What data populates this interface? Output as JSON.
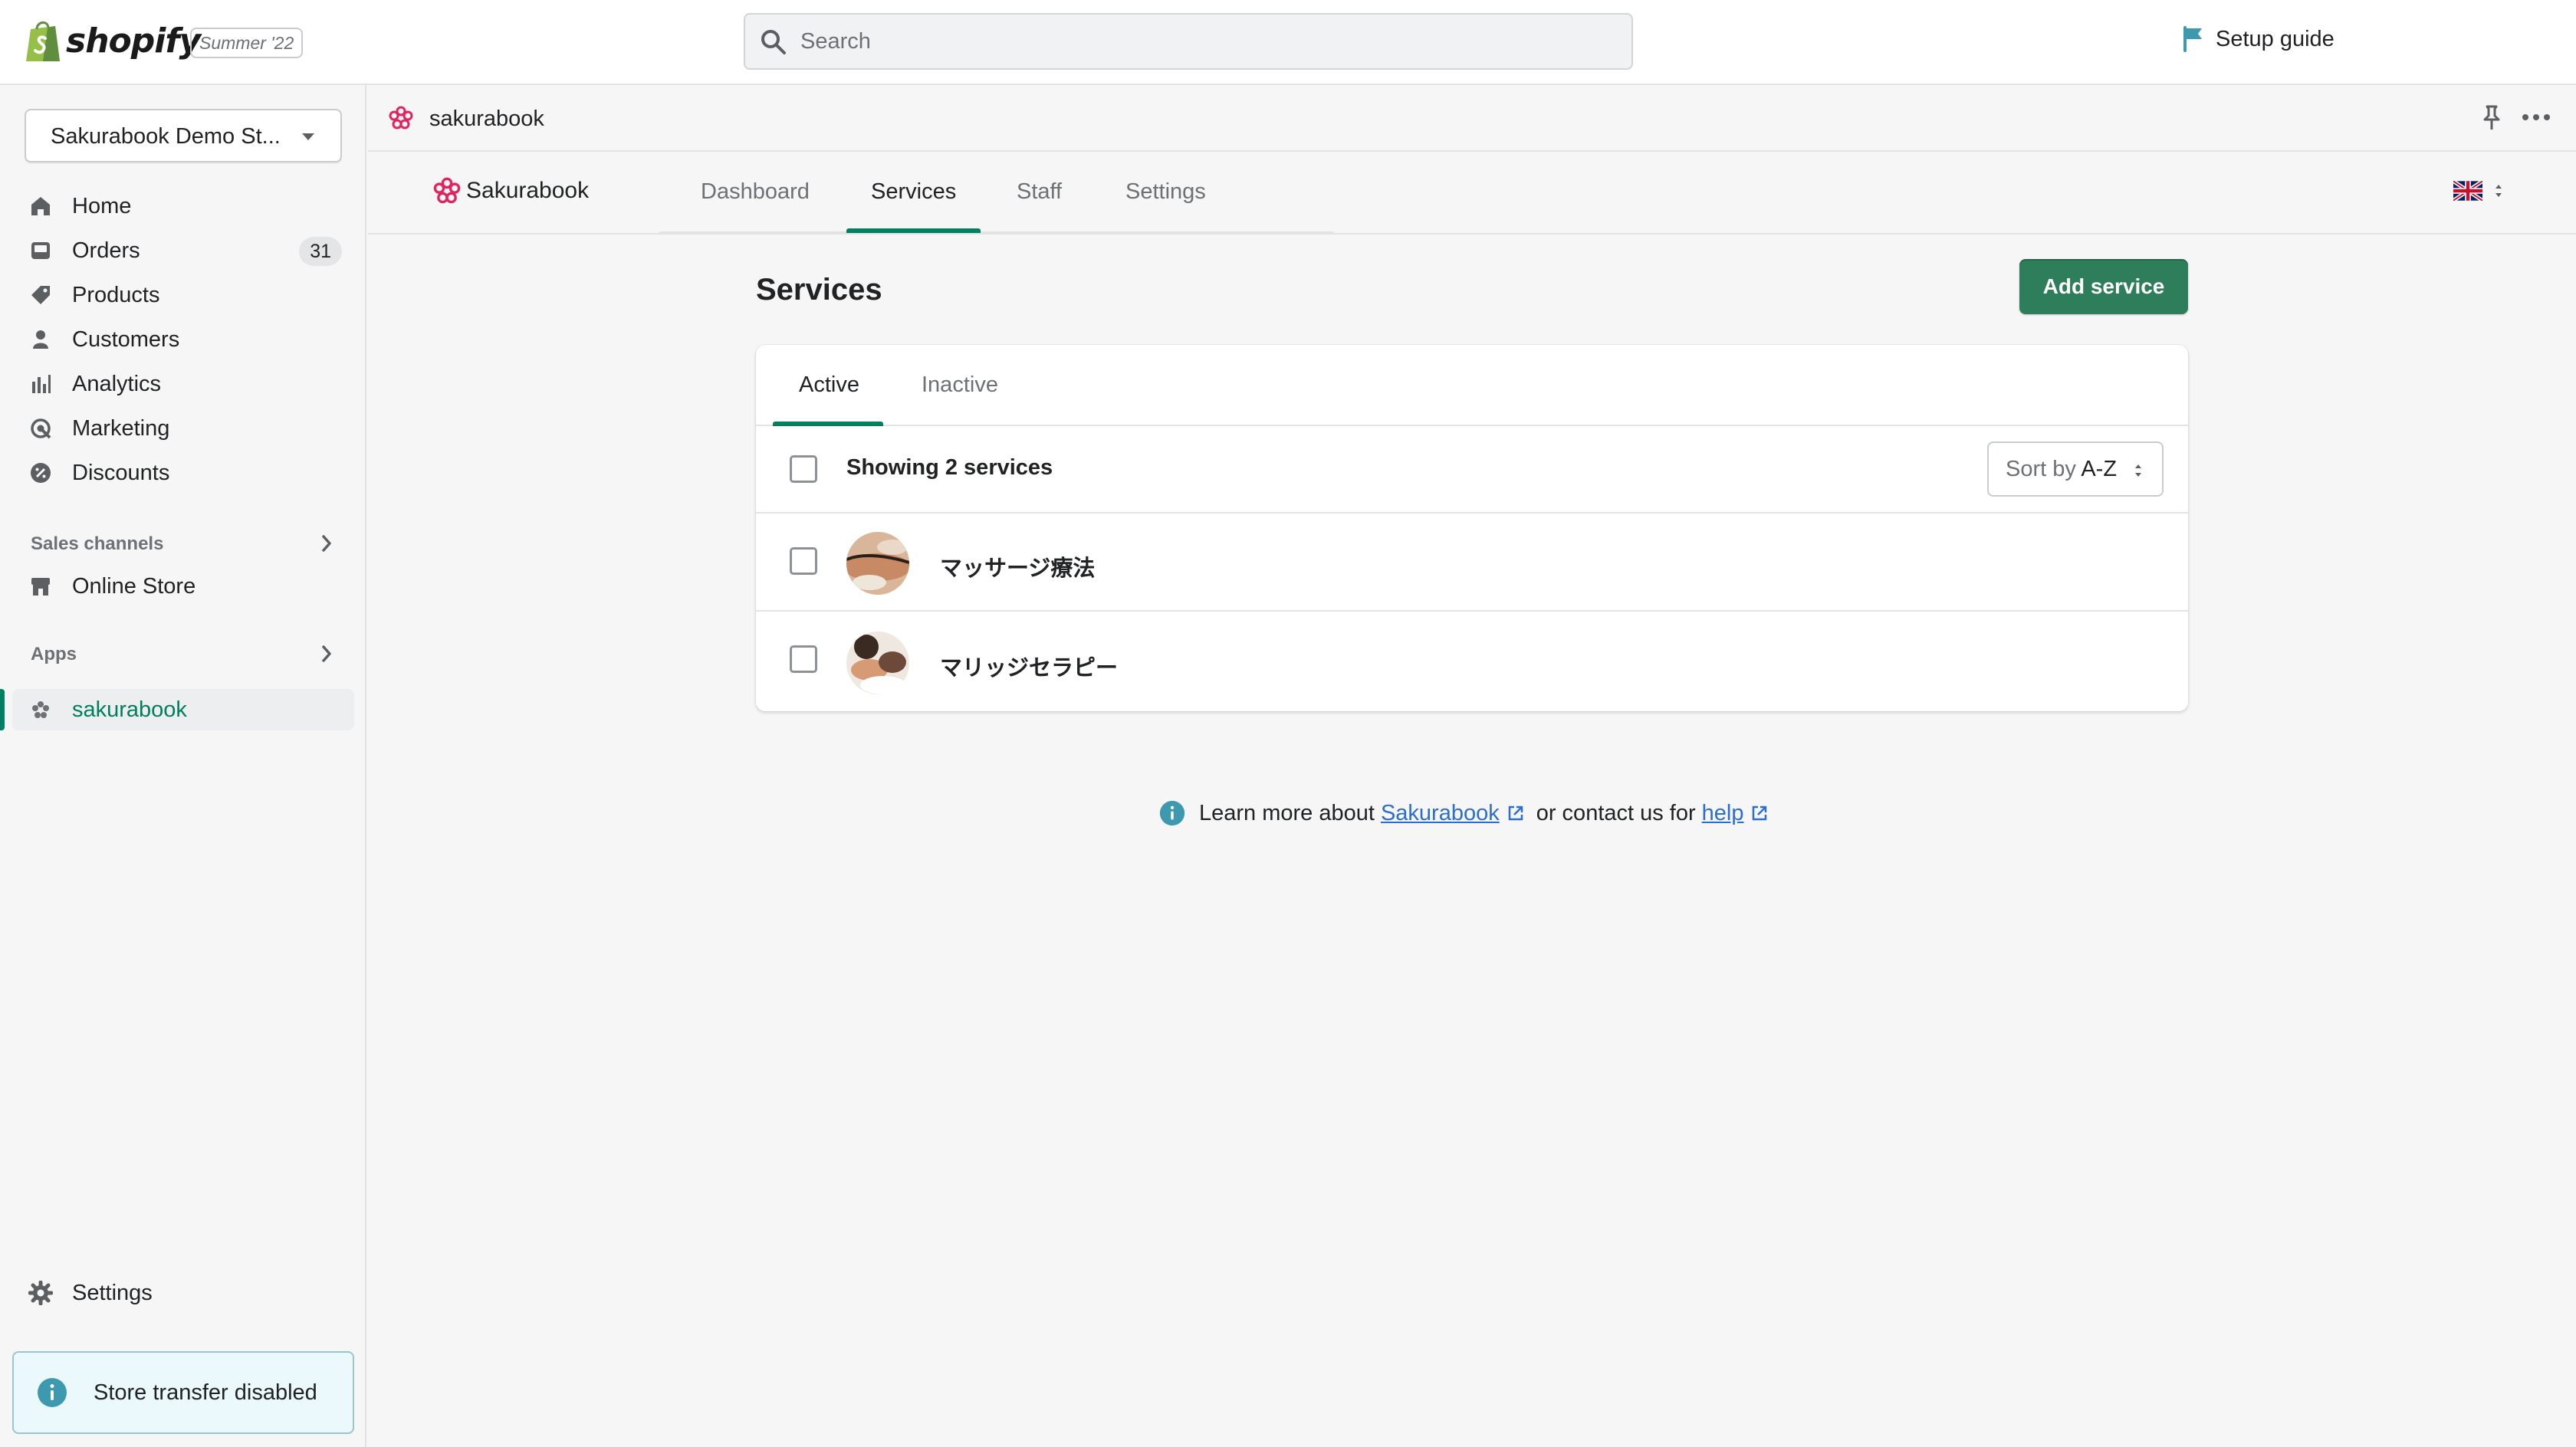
{
  "topbar": {
    "brand": "shopify",
    "edition": "Summer '22",
    "search_placeholder": "Search",
    "setup_guide": "Setup guide"
  },
  "sidebar": {
    "store_name": "Sakurabook Demo St...",
    "nav": [
      {
        "label": "Home",
        "icon": "home-icon"
      },
      {
        "label": "Orders",
        "icon": "orders-icon",
        "badge": "31"
      },
      {
        "label": "Products",
        "icon": "tag-icon"
      },
      {
        "label": "Customers",
        "icon": "person-icon"
      },
      {
        "label": "Analytics",
        "icon": "bar-chart-icon"
      },
      {
        "label": "Marketing",
        "icon": "target-icon"
      },
      {
        "label": "Discounts",
        "icon": "discount-icon"
      }
    ],
    "sales_channels_header": "Sales channels",
    "online_store": "Online Store",
    "apps_header": "Apps",
    "app_item": "sakurabook",
    "settings": "Settings",
    "store_transfer": "Store transfer disabled"
  },
  "app": {
    "title": "sakurabook",
    "brand": "Sakurabook",
    "tabs": [
      "Dashboard",
      "Services",
      "Staff",
      "Settings"
    ],
    "selected_tab": "Services",
    "language_icon": "uk-flag-icon"
  },
  "main": {
    "page_title": "Services",
    "add_button": "Add service",
    "card_tabs": [
      "Active",
      "Inactive"
    ],
    "showing": "Showing 2 services",
    "sort_label": "Sort by",
    "sort_value": "A-Z",
    "services": [
      {
        "name": "マッサージ療法"
      },
      {
        "name": "マリッジセラピー"
      }
    ]
  },
  "footer": {
    "learn_prefix": "Learn more about",
    "learn_link": "Sakurabook",
    "contact_text": "or contact us for",
    "help_link": "help"
  },
  "colors": {
    "accent": "#008060",
    "primary_button": "#2e7d5b",
    "link": "#2c6ecb",
    "info": "#3d9aae"
  }
}
